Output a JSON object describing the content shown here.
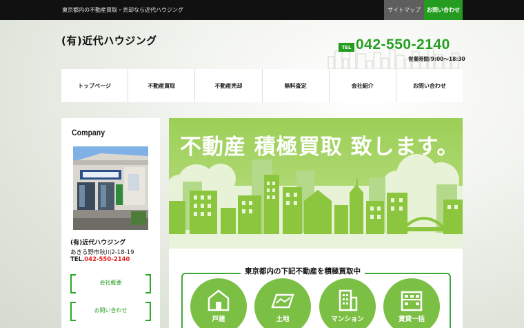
{
  "topbar": {
    "tagline": "東京都内の不動産買取・売却なら近代ハウジング",
    "sitemap_label": "サイトマップ",
    "contact_label": "お問い合わせ"
  },
  "header": {
    "title": "(有)近代ハウジング",
    "tel_badge": "TEL",
    "tel_number": "042-550-2140",
    "hours": "営業時間/9:00～18:30"
  },
  "nav": {
    "items": [
      "トップページ",
      "不動産買取",
      "不動産売却",
      "無料査定",
      "会社紹介",
      "お問い合わせ"
    ]
  },
  "sidebar": {
    "heading": "Company",
    "company_name": "(有)近代ハウジング",
    "address": "あきる野市秋川2-18-19",
    "tel_prefix": "TEL.",
    "tel_number": "042-550-2140",
    "buttons": [
      "会社概要",
      "お問い合わせ"
    ]
  },
  "main": {
    "banner_title": "不動産 積極買取 致します。",
    "lower_title": "東京都内の下記不動産を積極買取中",
    "categories": [
      {
        "label": "戸建",
        "icon": "house-icon"
      },
      {
        "label": "土地",
        "icon": "land-icon"
      },
      {
        "label": "マンション",
        "icon": "building-icon"
      },
      {
        "label": "賃貸一括",
        "icon": "apartment-icon"
      }
    ]
  },
  "colors": {
    "accent_green": "#239c1f",
    "banner_green": "#8cc63f",
    "circle_green": "#7bbf44",
    "tel_red": "#e02020"
  }
}
